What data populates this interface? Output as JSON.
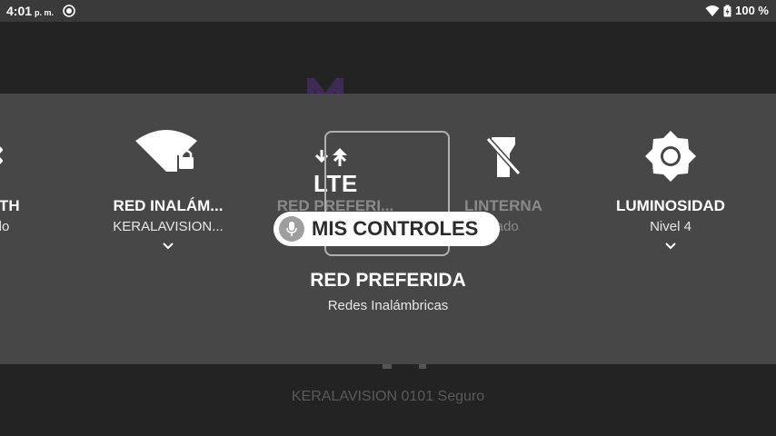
{
  "status_bar": {
    "time": "4:01",
    "time_suffix": "p. m.",
    "battery": "100 %",
    "icons": [
      "cast-icon",
      "wifi-icon",
      "battery-icon"
    ]
  },
  "background": {
    "network_status": "KERALAVISION 0101 Seguro"
  },
  "quick_settings": {
    "tiles": [
      {
        "title": "TOOTH",
        "subtitle": "ndido",
        "icon": "bluetooth-icon"
      },
      {
        "title": "RED INALÁM...",
        "subtitle": "KERALAVISION...",
        "icon": "wifi-lock-icon"
      },
      {
        "title": "RED PREFERI...",
        "subtitle": "",
        "icon": "lte-icon",
        "lte_text": "LTE"
      },
      {
        "title": "LINTERNA",
        "subtitle": "gado",
        "icon": "flashlight-off-icon"
      },
      {
        "title": "LUMINOSIDAD",
        "subtitle": "Nivel 4",
        "icon": "brightness-icon"
      }
    ],
    "selected": {
      "title": "RED PREFERIDA",
      "subtitle": "Redes Inalámbricas"
    }
  },
  "voice_pill": {
    "label": "MIS CONTROLES",
    "icon": "mic-icon"
  },
  "colors": {
    "panel": "#474747",
    "background": "#232323",
    "status_bar": "#3a3a3a"
  }
}
